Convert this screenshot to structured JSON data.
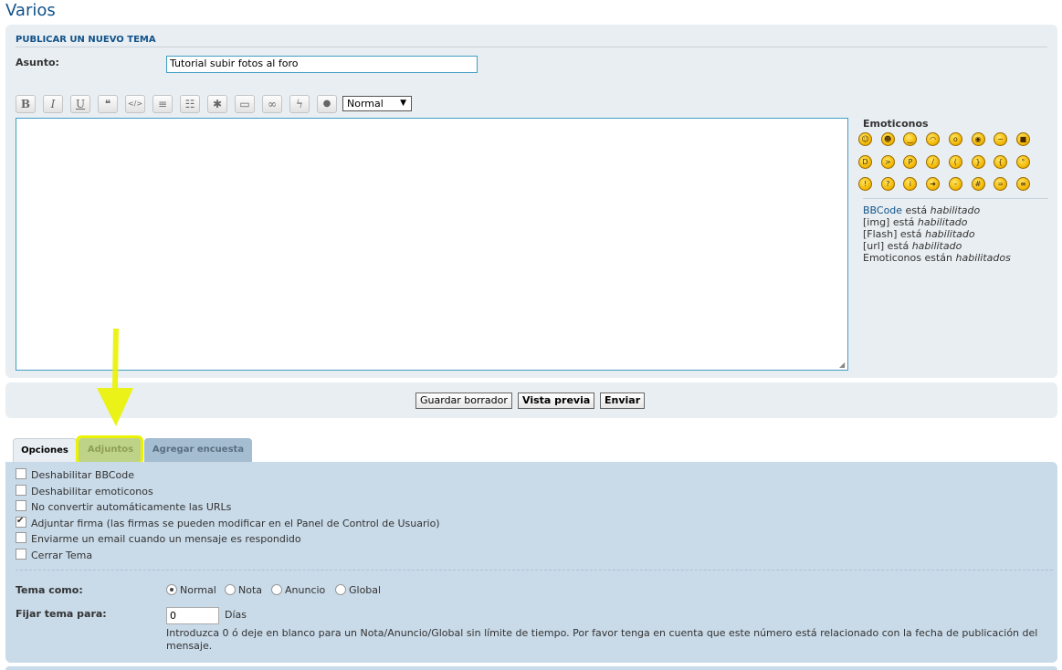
{
  "page": {
    "title": "Varios"
  },
  "post_form": {
    "heading": "PUBLICAR UN NUEVO TEMA",
    "subject_label": "Asunto:",
    "subject_value": "Tutorial subir fotos al foro",
    "font_size_select": "Normal",
    "toolbar": [
      {
        "name": "bold",
        "glyph": "B"
      },
      {
        "name": "italic",
        "glyph": "I"
      },
      {
        "name": "underline",
        "glyph": "U"
      },
      {
        "name": "quote",
        "glyph": "❝"
      },
      {
        "name": "code",
        "glyph": "</>"
      },
      {
        "name": "list",
        "glyph": "≡"
      },
      {
        "name": "ordered-list",
        "glyph": "☷"
      },
      {
        "name": "list-item",
        "glyph": "✱"
      },
      {
        "name": "image",
        "glyph": "▭"
      },
      {
        "name": "link",
        "glyph": "∞"
      },
      {
        "name": "flash",
        "glyph": "ϟ"
      },
      {
        "name": "color",
        "glyph": "●"
      }
    ]
  },
  "sidebar": {
    "emoticons_title": "Emoticonos",
    "emoticons": [
      "very-happy",
      "smile",
      "wink",
      "sad",
      "surprised",
      "shocked",
      "confused",
      "cool",
      "laughing",
      "mad",
      "razz",
      "embarrassed",
      "crying",
      "evil",
      "twisted-evil",
      "rolleyes",
      "exclamation",
      "question",
      "idea",
      "arrow",
      "neutral",
      "mr-green",
      "geek",
      "uber-geek"
    ],
    "status": {
      "bbcode_link": "BBCode",
      "bbcode_text": " está ",
      "bbcode_state": "habilitado",
      "img_text": "[img] está ",
      "img_state": "habilitado",
      "flash_text": "[Flash] está ",
      "flash_state": "habilitado",
      "url_text": "[url] está ",
      "url_state": "habilitado",
      "emo_text": "Emoticonos están ",
      "emo_state": "habilitados"
    }
  },
  "buttons": {
    "save_draft": "Guardar borrador",
    "preview": "Vista previa",
    "submit": "Enviar"
  },
  "tabs": [
    {
      "label": "Opciones",
      "active": true
    },
    {
      "label": "Adjuntos",
      "active": false
    },
    {
      "label": "Agregar encuesta",
      "active": false
    }
  ],
  "options": {
    "checkboxes": [
      {
        "label": "Deshabilitar BBCode",
        "checked": false
      },
      {
        "label": "Deshabilitar emoticonos",
        "checked": false
      },
      {
        "label": "No convertir automáticamente las URLs",
        "checked": false
      },
      {
        "label": "Adjuntar firma (las firmas se pueden modificar en el Panel de Control de Usuario)",
        "checked": true
      },
      {
        "label": "Enviarme un email cuando un mensaje es respondido",
        "checked": false
      },
      {
        "label": "Cerrar Tema",
        "checked": false
      }
    ],
    "topic_type_label": "Tema como:",
    "topic_types": [
      {
        "label": "Normal",
        "selected": true
      },
      {
        "label": "Nota",
        "selected": false
      },
      {
        "label": "Anuncio",
        "selected": false
      },
      {
        "label": "Global",
        "selected": false
      }
    ],
    "stick_label": "Fijar tema para:",
    "stick_value": "0",
    "stick_unit": "Días",
    "stick_note": "Introduzca 0 ó deje en blanco para un Nota/Anuncio/Global sin límite de tiempo. Por favor tenga en cuenta que este número está relacionado con la fecha de publicación del mensaje."
  },
  "colors": {
    "accent": "#105289",
    "panel": "#e9eef2",
    "options_panel": "#c9dae8",
    "highlight": "#eaf200"
  }
}
